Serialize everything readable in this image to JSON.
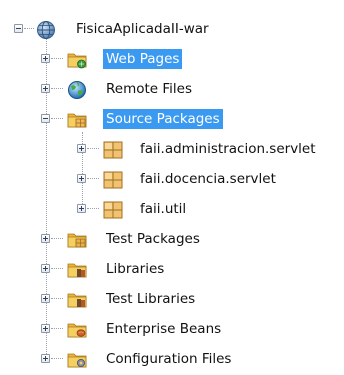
{
  "project_tree": {
    "root_label": "FisicaAplicadaII-war",
    "nodes": [
      {
        "label": "Web Pages",
        "icon": "web-pages-folder-icon",
        "selected": true,
        "expanded": false
      },
      {
        "label": "Remote Files",
        "icon": "remote-files-globe-icon",
        "selected": false,
        "expanded": false
      },
      {
        "label": "Source Packages",
        "icon": "source-packages-folder-icon",
        "selected": true,
        "expanded": true,
        "children": [
          {
            "label": "faii.administracion.servlet",
            "icon": "java-package-icon"
          },
          {
            "label": "faii.docencia.servlet",
            "icon": "java-package-icon"
          },
          {
            "label": "faii.util",
            "icon": "java-package-icon"
          }
        ]
      },
      {
        "label": "Test Packages",
        "icon": "test-packages-folder-icon",
        "selected": false,
        "expanded": false
      },
      {
        "label": "Libraries",
        "icon": "libraries-folder-icon",
        "selected": false,
        "expanded": false
      },
      {
        "label": "Test Libraries",
        "icon": "test-libraries-folder-icon",
        "selected": false,
        "expanded": false
      },
      {
        "label": "Enterprise Beans",
        "icon": "enterprise-beans-folder-icon",
        "selected": false,
        "expanded": false
      },
      {
        "label": "Configuration Files",
        "icon": "configuration-files-folder-icon",
        "selected": false,
        "expanded": false
      }
    ]
  },
  "colors": {
    "selection": "#3a99f0",
    "folder": "#e8b43c",
    "package": "#e6b04a"
  }
}
